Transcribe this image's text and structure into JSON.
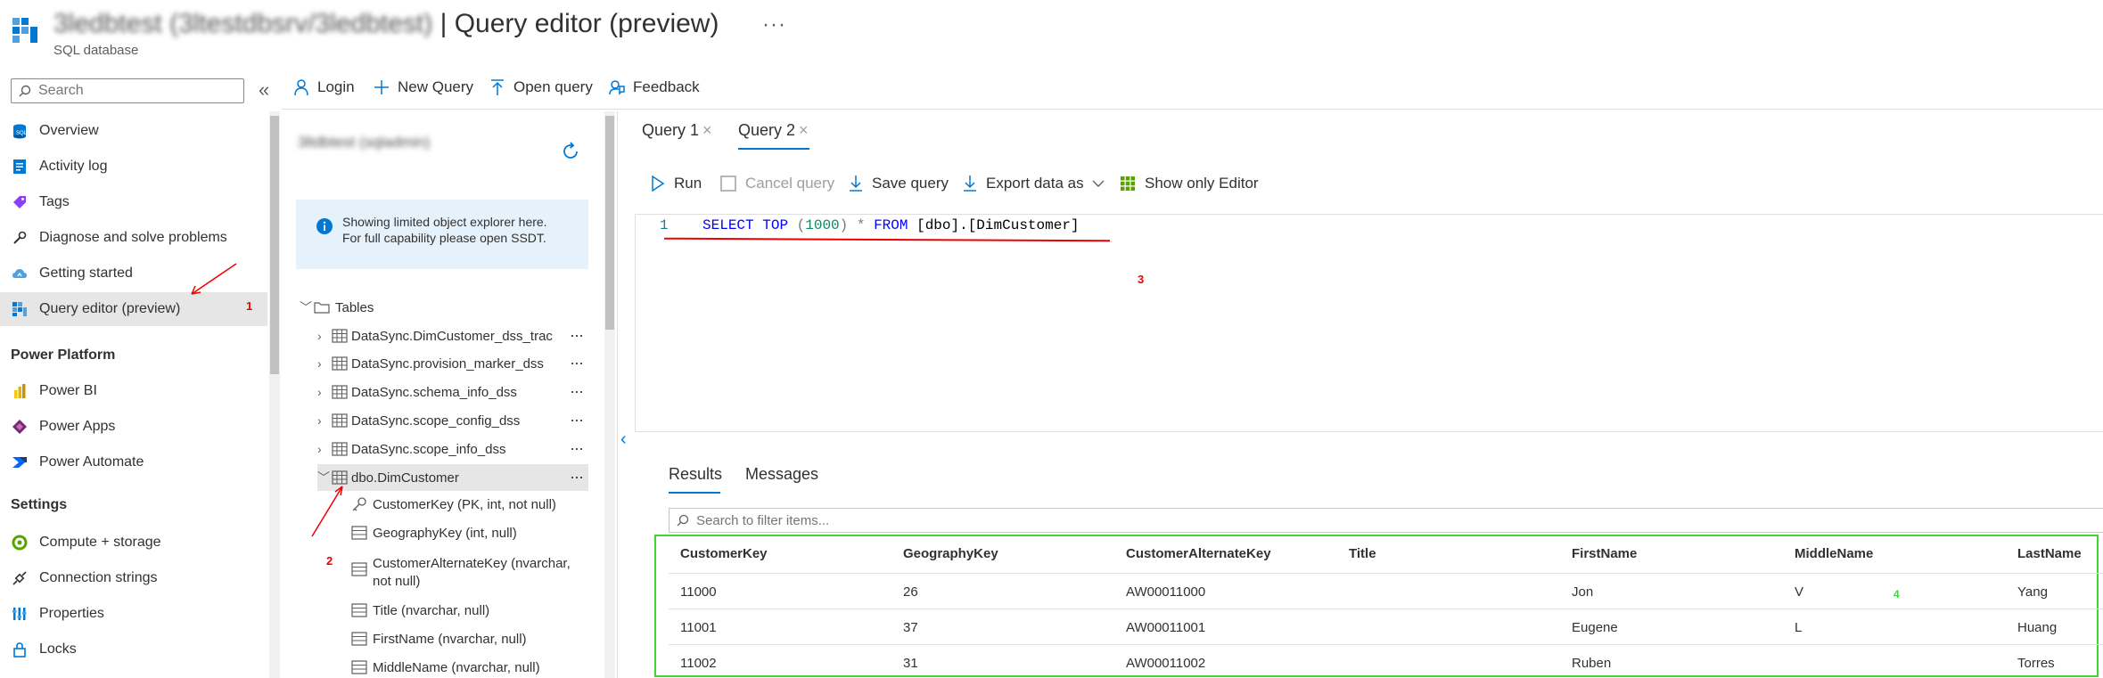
{
  "header": {
    "title_blurred": "3ledbtest (3ltestdbsrv/3ledbtest)",
    "title_sep": " | ",
    "title": "Query editor (preview)",
    "subtitle": "SQL database",
    "more": "···"
  },
  "search": {
    "placeholder": "Search"
  },
  "sidebar": {
    "items": [
      {
        "label": "Overview",
        "icon": "sql-database-icon"
      },
      {
        "label": "Activity log",
        "icon": "activity-log-icon"
      },
      {
        "label": "Tags",
        "icon": "tag-icon"
      },
      {
        "label": "Diagnose and solve problems",
        "icon": "wrench-icon"
      },
      {
        "label": "Getting started",
        "icon": "cloud-icon"
      },
      {
        "label": "Query editor (preview)",
        "icon": "query-editor-icon"
      }
    ],
    "power_platform_title": "Power Platform",
    "power_platform": [
      {
        "label": "Power BI",
        "icon": "power-bi-icon"
      },
      {
        "label": "Power Apps",
        "icon": "power-apps-icon"
      },
      {
        "label": "Power Automate",
        "icon": "power-automate-icon"
      }
    ],
    "settings_title": "Settings",
    "settings": [
      {
        "label": "Compute + storage",
        "icon": "compute-icon"
      },
      {
        "label": "Connection strings",
        "icon": "plug-icon"
      },
      {
        "label": "Properties",
        "icon": "properties-icon"
      },
      {
        "label": "Locks",
        "icon": "lock-icon"
      }
    ]
  },
  "toolbar": {
    "login": "Login",
    "new_query": "New Query",
    "open_query": "Open query",
    "feedback": "Feedback"
  },
  "explorer": {
    "db_name_blurred": "3ltdbtest (sqladmin)",
    "info_line1": "Showing limited object explorer here.",
    "info_line2": "For full capability please open SSDT.",
    "tables_label": "Tables",
    "tables": [
      "DataSync.DimCustomer_dss_trac",
      "DataSync.provision_marker_dss",
      "DataSync.schema_info_dss",
      "DataSync.scope_config_dss",
      "DataSync.scope_info_dss",
      "dbo.DimCustomer"
    ],
    "columns": [
      "CustomerKey (PK, int, not null)",
      "GeographyKey (int, null)",
      "CustomerAlternateKey (nvarchar,",
      "not null)",
      "Title (nvarchar, null)",
      "FirstName (nvarchar, null)",
      "MiddleName (nvarchar, null)"
    ],
    "dots": "···"
  },
  "tabs": [
    {
      "label": "Query 1",
      "close": "×"
    },
    {
      "label": "Query 2",
      "close": "×"
    }
  ],
  "query_toolbar": {
    "run": "Run",
    "cancel": "Cancel query",
    "save": "Save query",
    "export": "Export data as",
    "show_editor": "Show only Editor"
  },
  "editor": {
    "line_number": "1",
    "tokens": {
      "select": "SELECT",
      "top": "TOP",
      "lp": " (",
      "num": "1000",
      "rp": ") ",
      "star": "*",
      "from": "FROM",
      "table": "[dbo].[DimCustomer]"
    }
  },
  "annotations": [
    "1",
    "2",
    "3",
    "4"
  ],
  "results": {
    "tabs": [
      "Results",
      "Messages"
    ],
    "filter_placeholder": "Search to filter items...",
    "columns": [
      "CustomerKey",
      "GeographyKey",
      "CustomerAlternateKey",
      "Title",
      "FirstName",
      "MiddleName",
      "LastName"
    ],
    "rows": [
      [
        "11000",
        "26",
        "AW00011000",
        "",
        "Jon",
        "V",
        "Yang"
      ],
      [
        "11001",
        "37",
        "AW00011001",
        "",
        "Eugene",
        "L",
        "Huang"
      ],
      [
        "11002",
        "31",
        "AW00011002",
        "",
        "Ruben",
        "",
        "Torres"
      ]
    ]
  },
  "colors": {
    "accent": "#0078d4",
    "annotation_red": "#e00000",
    "highlight_green": "#3dd63d"
  }
}
